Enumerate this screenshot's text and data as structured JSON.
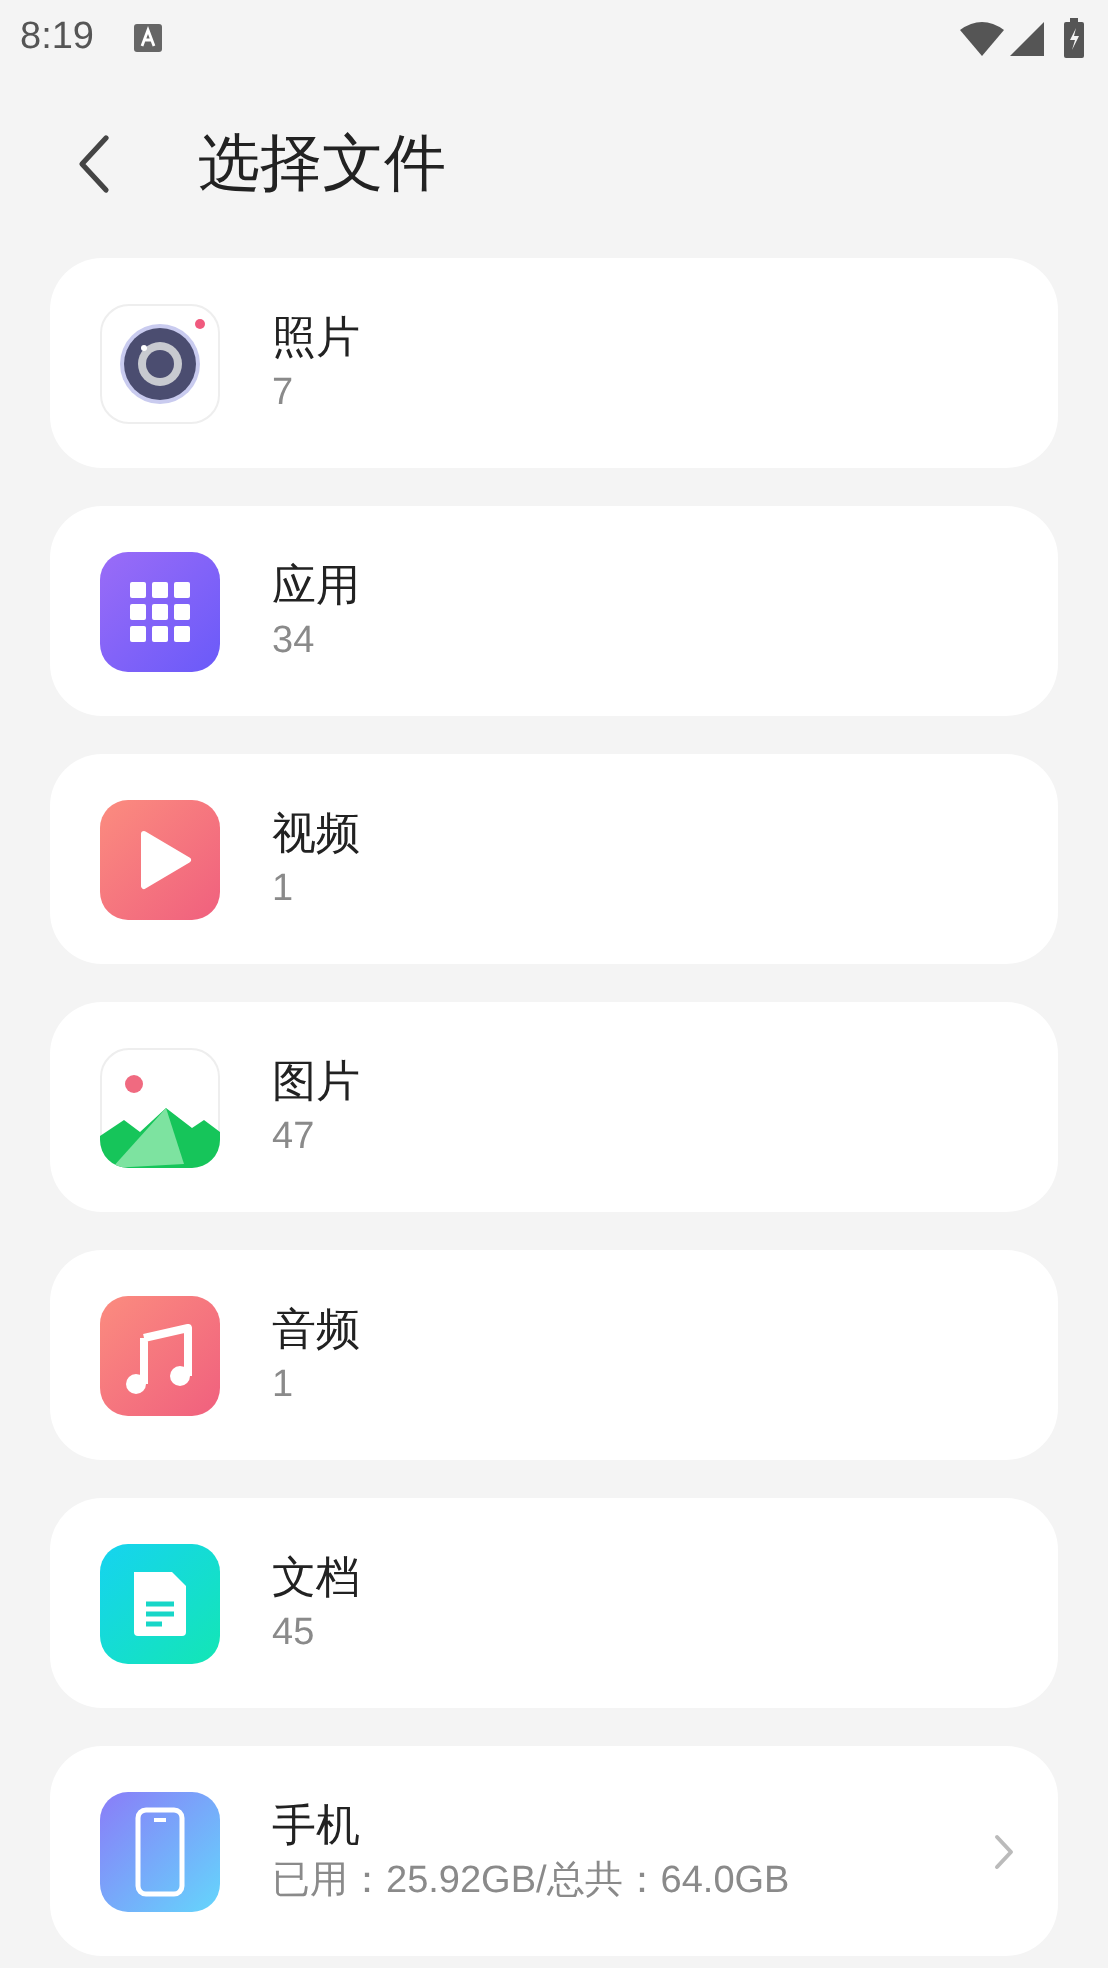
{
  "status_bar": {
    "time": "8:19"
  },
  "header": {
    "title": "选择文件"
  },
  "items": [
    {
      "kind": "photos",
      "title": "照片",
      "subtitle": "7"
    },
    {
      "kind": "apps",
      "title": "应用",
      "subtitle": "34"
    },
    {
      "kind": "video",
      "title": "视频",
      "subtitle": "1"
    },
    {
      "kind": "images",
      "title": "图片",
      "subtitle": "47"
    },
    {
      "kind": "audio",
      "title": "音频",
      "subtitle": "1"
    },
    {
      "kind": "documents",
      "title": "文档",
      "subtitle": "45"
    },
    {
      "kind": "storage",
      "title": "手机",
      "subtitle": "已用：25.92GB/总共：64.0GB"
    }
  ]
}
